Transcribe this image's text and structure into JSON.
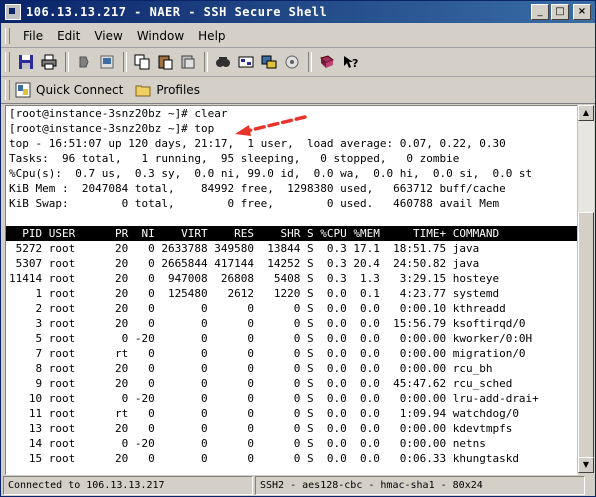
{
  "window": {
    "title": "106.13.13.217 - NAER - SSH Secure Shell"
  },
  "title_buttons": [
    "_",
    "□",
    "×"
  ],
  "menu": [
    "File",
    "Edit",
    "View",
    "Window",
    "Help"
  ],
  "toolbar_icons": [
    "save-icon",
    "print-icon",
    "disconnect-icon",
    "connect-icon",
    "copy-icon",
    "paste-icon",
    "paste-special-icon",
    "find-icon",
    "settings-icon",
    "file-transfer-icon",
    "key-icon",
    "profile-icon",
    "help-icon"
  ],
  "quickbar": {
    "quick_connect": "Quick Connect",
    "profiles": "Profiles"
  },
  "terminal": {
    "lines": [
      "[root@instance-3snz20bz ~]# clear",
      "[root@instance-3snz20bz ~]# top",
      "top - 16:51:07 up 120 days, 21:17,  1 user,  load average: 0.07, 0.22, 0.30",
      "Tasks:  96 total,   1 running,  95 sleeping,   0 stopped,   0 zombie",
      "%Cpu(s):  0.7 us,  0.3 sy,  0.0 ni, 99.0 id,  0.0 wa,  0.0 hi,  0.0 si,  0.0 st",
      "KiB Mem :  2047084 total,    84992 free,  1298380 used,   663712 buff/cache",
      "KiB Swap:        0 total,        0 free,        0 used.   460788 avail Mem",
      ""
    ],
    "header": "  PID USER      PR  NI    VIRT    RES    SHR S %CPU %MEM     TIME+ COMMAND        ",
    "processes": [
      " 5272 root      20   0 2633788 349580  13844 S  0.3 17.1  18:51.75 java",
      " 5307 root      20   0 2665844 417144  14252 S  0.3 20.4  24:50.82 java",
      "11414 root      20   0  947008  26808   5408 S  0.3  1.3   3:29.15 hosteye",
      "    1 root      20   0  125480   2612   1220 S  0.0  0.1   4:23.77 systemd",
      "    2 root      20   0       0      0      0 S  0.0  0.0   0:00.10 kthreadd",
      "    3 root      20   0       0      0      0 S  0.0  0.0  15:56.79 ksoftirqd/0",
      "    5 root       0 -20       0      0      0 S  0.0  0.0   0:00.00 kworker/0:0H",
      "    7 root      rt   0       0      0      0 S  0.0  0.0   0:00.00 migration/0",
      "    8 root      20   0       0      0      0 S  0.0  0.0   0:00.00 rcu_bh",
      "    9 root      20   0       0      0      0 S  0.0  0.0  45:47.62 rcu_sched",
      "   10 root       0 -20       0      0      0 S  0.0  0.0   0:00.00 lru-add-drai+",
      "   11 root      rt   0       0      0      0 S  0.0  0.0   1:09.94 watchdog/0",
      "   13 root      20   0       0      0      0 S  0.0  0.0   0:00.00 kdevtmpfs",
      "   14 root       0 -20       0      0      0 S  0.0  0.0   0:00.00 netns",
      "   15 root      20   0       0      0      0 S  0.0  0.0   0:06.33 khungtaskd"
    ]
  },
  "status": {
    "connection": "Connected to 106.13.13.217",
    "cipher": "SSH2 - aes128-cbc - hmac-sha1 - 80x24"
  },
  "colors": {
    "titlebar": "#0a246a",
    "arrow": "#e8342a",
    "terminal_bg": "#ffffff"
  }
}
